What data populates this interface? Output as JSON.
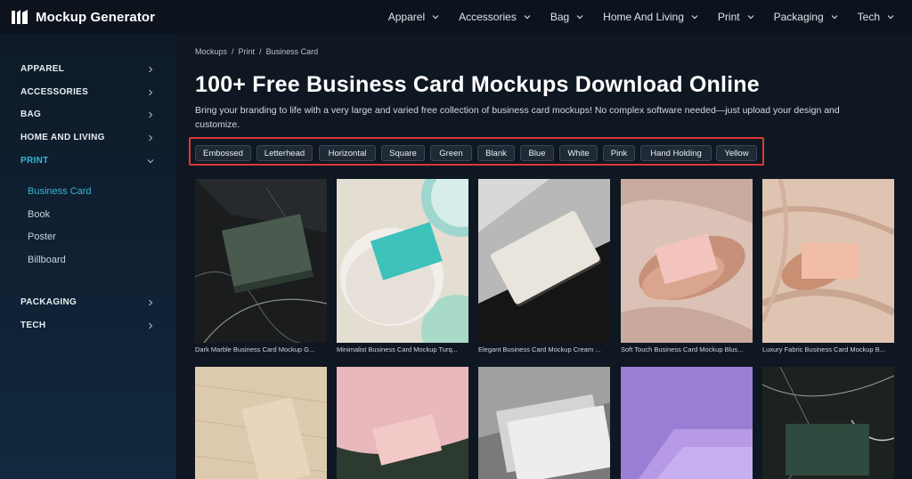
{
  "app": {
    "name": "Mockup Generator"
  },
  "topnav": [
    {
      "label": "Apparel"
    },
    {
      "label": "Accessories"
    },
    {
      "label": "Bag"
    },
    {
      "label": "Home And Living"
    },
    {
      "label": "Print"
    },
    {
      "label": "Packaging"
    },
    {
      "label": "Tech"
    }
  ],
  "sidebar": {
    "groups": [
      {
        "label": "APPAREL"
      },
      {
        "label": "ACCESSORIES"
      },
      {
        "label": "BAG"
      },
      {
        "label": "HOME AND LIVING"
      },
      {
        "label": "PRINT"
      },
      {
        "label": "PACKAGING"
      },
      {
        "label": "TECH"
      }
    ],
    "print_items": [
      {
        "label": "Business Card"
      },
      {
        "label": "Book"
      },
      {
        "label": "Poster"
      },
      {
        "label": "Billboard"
      }
    ]
  },
  "breadcrumb": [
    "Mockups",
    "/",
    "Print",
    "/",
    "Business Card"
  ],
  "page": {
    "title": "100+ Free Business Card Mockups Download Online",
    "description": "Bring your branding to life with a very large and varied free collection of business card mockups! No complex software needed—just upload your design and customize."
  },
  "tags": [
    "Embossed",
    "Letterhead",
    "Horizontal",
    "Square",
    "Green",
    "Blank",
    "Blue",
    "White",
    "Pink",
    "Hand Holding",
    "Yellow"
  ],
  "mockups": [
    {
      "caption": "Dark Marble Business Card Mockup G..."
    },
    {
      "caption": "Minimalist Business Card Mockup Turq..."
    },
    {
      "caption": "Elegant Business Card Mockup Cream ..."
    },
    {
      "caption": "Soft Touch Business Card Mockup Blus..."
    },
    {
      "caption": "Luxury Fabric Business Card Mockup B..."
    }
  ],
  "colors": {
    "accent": "#38b6d6",
    "highlight_border": "#d83a34",
    "background": "#0f1722"
  }
}
